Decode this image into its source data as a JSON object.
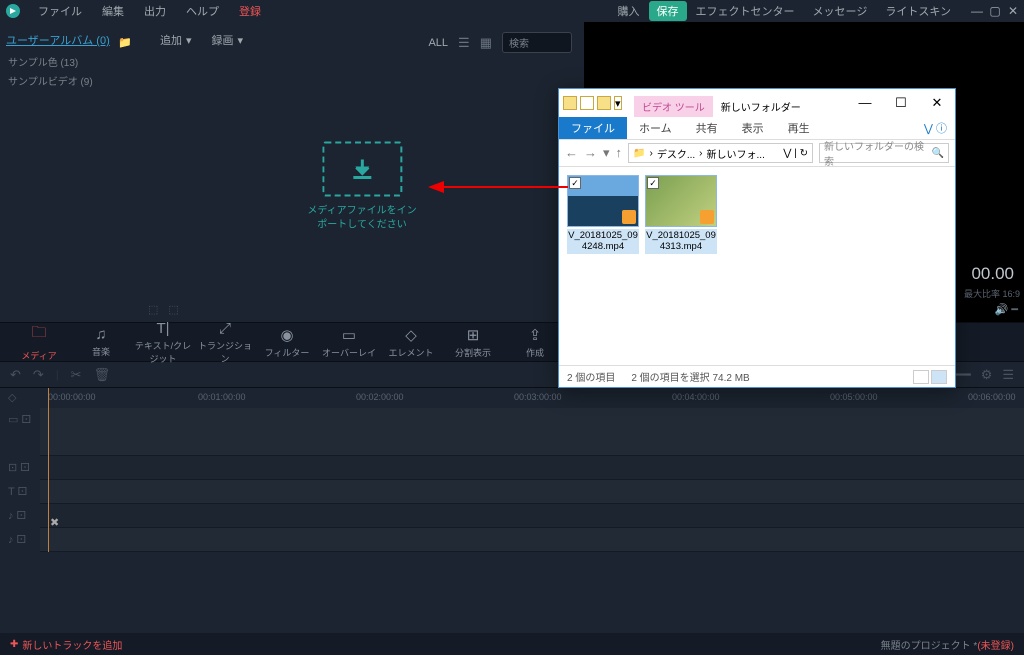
{
  "menubar": {
    "items": [
      "ファイル",
      "編集",
      "出力",
      "ヘルプ"
    ],
    "register": "登録",
    "right": {
      "buy": "購入",
      "save": "保存",
      "effects": "エフェクトセンター",
      "messages": "メッセージ",
      "skin": "ライトスキン"
    }
  },
  "sidebar": {
    "album_link": "ユーザーアルバム (0)",
    "items": [
      "サンプル色 (13)",
      "サンプルビデオ (9)"
    ]
  },
  "media_top": {
    "add": "追加",
    "record": "録画",
    "all": "ALL",
    "search_ph": "検索"
  },
  "dropzone": {
    "line1": "メディアファイルをイン",
    "line2": "ポートしてください"
  },
  "preview": {
    "ratio": "最大比率 16:9",
    "time": "00.00"
  },
  "tooltabs": [
    {
      "icon": "folder",
      "label": "メディア"
    },
    {
      "icon": "music",
      "label": "音楽"
    },
    {
      "icon": "text",
      "label": "テキスト/クレジット"
    },
    {
      "icon": "trans",
      "label": "トランジション"
    },
    {
      "icon": "filter",
      "label": "フィルター"
    },
    {
      "icon": "overlay",
      "label": "オーバーレイ"
    },
    {
      "icon": "element",
      "label": "エレメント"
    },
    {
      "icon": "split",
      "label": "分割表示"
    },
    {
      "icon": "export",
      "label": "作成"
    }
  ],
  "ruler": [
    "00:00:00:00",
    "00:01:00:00",
    "00:02:00:00",
    "00:03:00:00",
    "00:04:00:00",
    "00:05:00:00",
    "00:06:00:00"
  ],
  "bottom": {
    "add_track": "新しいトラックを追加",
    "project": "無題のプロジェクト *",
    "unsaved": "(未登録)"
  },
  "explorer": {
    "video_tools": "ビデオ ツール",
    "folder_title": "新しいフォルダー",
    "menu": {
      "file": "ファイル",
      "home": "ホーム",
      "share": "共有",
      "view": "表示",
      "play": "再生"
    },
    "path": {
      "seg1": "デスク...",
      "seg2": "新しいフォ..."
    },
    "search_ph": "新しいフォルダーの検索",
    "items": [
      {
        "name": "V_20181025_094248.mp4"
      },
      {
        "name": "V_20181025_094313.mp4"
      }
    ],
    "status": {
      "count": "2 個の項目",
      "sel": "2 個の項目を選択 74.2 MB"
    }
  }
}
